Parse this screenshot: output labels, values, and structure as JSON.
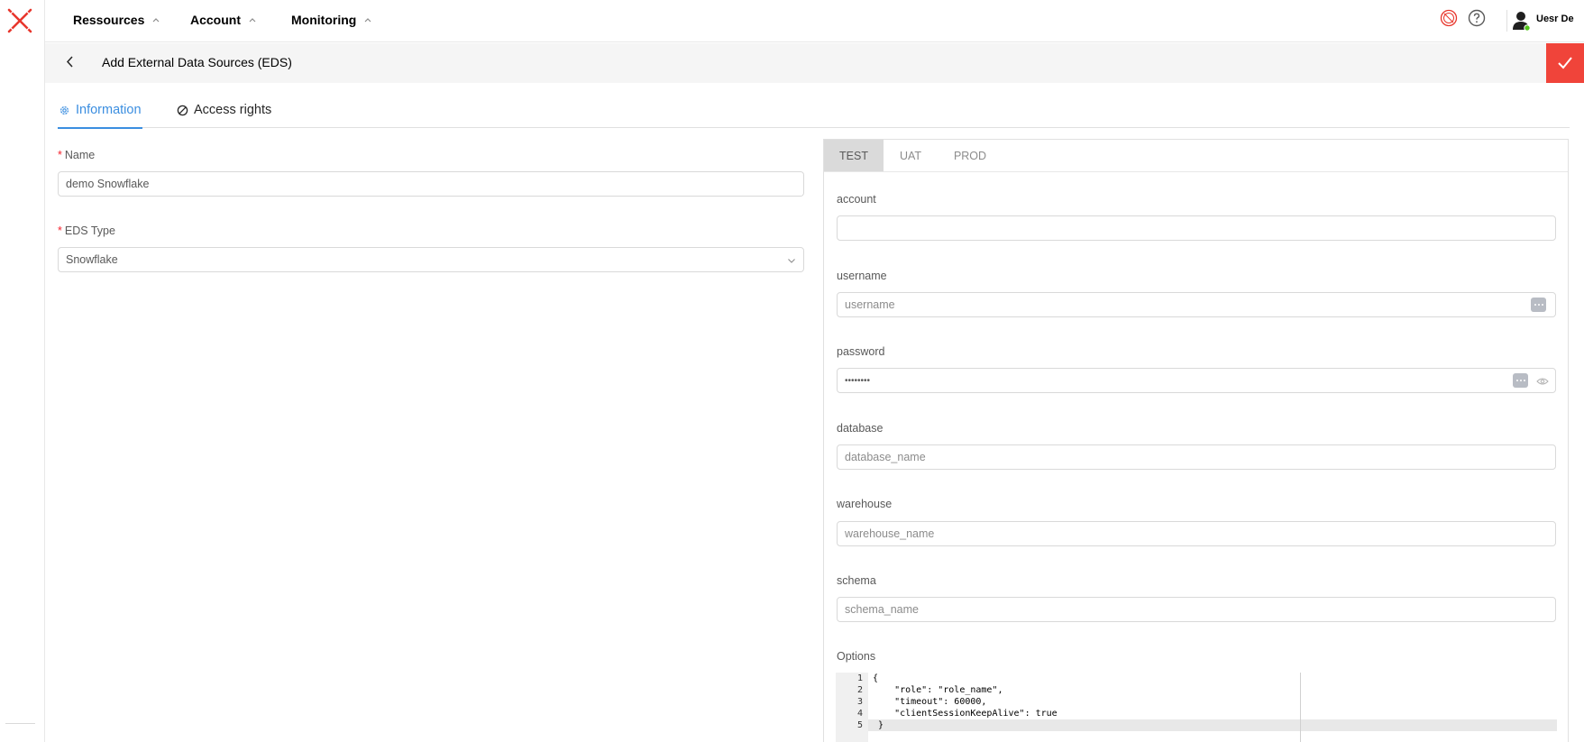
{
  "nav": {
    "items": [
      {
        "label": "Ressources"
      },
      {
        "label": "Account"
      },
      {
        "label": "Monitoring"
      }
    ],
    "user_name": "Uesr De"
  },
  "page": {
    "title": "Add External Data Sources (EDS)"
  },
  "tabs": [
    {
      "label": "Information",
      "active": true,
      "icon": "gear-icon"
    },
    {
      "label": "Access rights",
      "active": false,
      "icon": "forbidden-icon"
    }
  ],
  "form": {
    "name": {
      "label": "Name",
      "value": "demo Snowflake",
      "required": true
    },
    "eds_type": {
      "label": "EDS Type",
      "value": "Snowflake",
      "required": true
    }
  },
  "env_tabs": [
    {
      "label": "TEST",
      "active": true
    },
    {
      "label": "UAT",
      "active": false
    },
    {
      "label": "PROD",
      "active": false
    }
  ],
  "env_form": {
    "account": {
      "label": "account",
      "value": "",
      "placeholder": ""
    },
    "username": {
      "label": "username",
      "placeholder": "username"
    },
    "password": {
      "label": "password",
      "value": "••••••••"
    },
    "database": {
      "label": "database",
      "placeholder": "database_name"
    },
    "warehouse": {
      "label": "warehouse",
      "placeholder": "warehouse_name"
    },
    "schema": {
      "label": "schema",
      "placeholder": "schema_name"
    },
    "options": {
      "label": "Options",
      "lines": [
        {
          "n": "1",
          "text": "{"
        },
        {
          "n": "2",
          "text": "    \"role\": \"role_name\","
        },
        {
          "n": "3",
          "text": "    \"timeout\": 60000,"
        },
        {
          "n": "4",
          "text": "    \"clientSessionKeepAlive\": true"
        },
        {
          "n": "5",
          "text": " }"
        }
      ]
    }
  },
  "colors": {
    "accent": "#3b8ee0",
    "brand": "#f0443a",
    "required": "#f5222d"
  }
}
